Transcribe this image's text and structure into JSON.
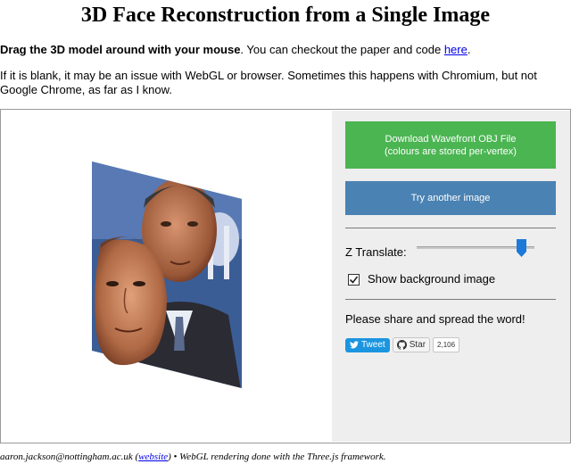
{
  "page": {
    "title": "3D Face Reconstruction from a Single Image",
    "intro_bold": "Drag the 3D model around with your mouse",
    "intro_rest": ". You can checkout the paper and code ",
    "intro_link": "here",
    "intro_end": ".",
    "note": "If it is blank, it may be an issue with WebGL or browser. Sometimes this happens with Chromium, but not Google Chrome, as far as I know."
  },
  "panel": {
    "download_line1": "Download Wavefront OBJ File",
    "download_line2": "(colours are stored per-vertex)",
    "try_another": "Try another image",
    "z_translate_label": "Z Translate:",
    "z_translate_level": 0.9,
    "show_bg_label": "Show background image",
    "show_bg_checked": true,
    "share_text": "Please share and spread the word!",
    "tweet_label": "Tweet",
    "star_label": "Star",
    "star_count": "2,106"
  },
  "footer": {
    "email": "aaron.jackson@nottingham.ac.uk (",
    "website_link": "website",
    "rest": ") • WebGL rendering done with the Three.js framework."
  },
  "colors": {
    "download_button": "#4bb552",
    "try_button": "#4a82b3",
    "panel_bg": "#eeeeee",
    "slider_thumb": "#1c7ad8",
    "twitter": "#1b95e0"
  }
}
